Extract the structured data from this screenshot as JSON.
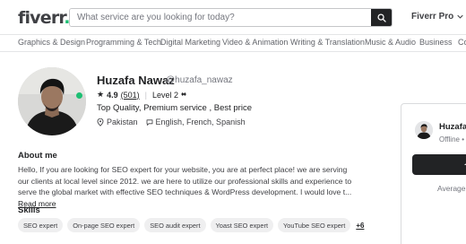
{
  "header": {
    "logo": "fiverr",
    "logo_dot": ".",
    "search_placeholder": "What service are you looking for today?",
    "pro_label": "Fiverr Pro"
  },
  "categories": [
    "Graphics & Design",
    "Programming & Tech",
    "Digital Marketing",
    "Video & Animation",
    "Writing & Translation",
    "Music & Audio",
    "Business",
    "Consu"
  ],
  "profile": {
    "name": "Huzafa Nawaz",
    "handle": "@huzafa_nawaz",
    "rating": "4.9",
    "review_count": "(501)",
    "level": "Level 2",
    "level_mark": "♦♦",
    "tagline": "Top Quality, Premium service , Best price",
    "country": "Pakistan",
    "languages": "English, French, Spanish"
  },
  "about": {
    "title": "About me",
    "text": "Hello, If you are looking for SEO expert for your website, you are at perfect place! we are serving our clients at local level since 2012. we are here to utilize our professional skills and experience to serve the global market with effective SEO techniques & WordPress development. I would love t...",
    "read_more": "Read more"
  },
  "skills": {
    "title": "Skills",
    "items": [
      "SEO expert",
      "On-page SEO expert",
      "SEO audit expert",
      "Yoast SEO expert",
      "YouTube SEO expert"
    ],
    "more": "+6"
  },
  "contact_card": {
    "name": "Huzafa",
    "status": "Offline •",
    "avg_label": "Average"
  },
  "colors": {
    "brand_green": "#1dbf73",
    "dark": "#222325",
    "text": "#404145",
    "chip_bg": "#efeff0"
  }
}
